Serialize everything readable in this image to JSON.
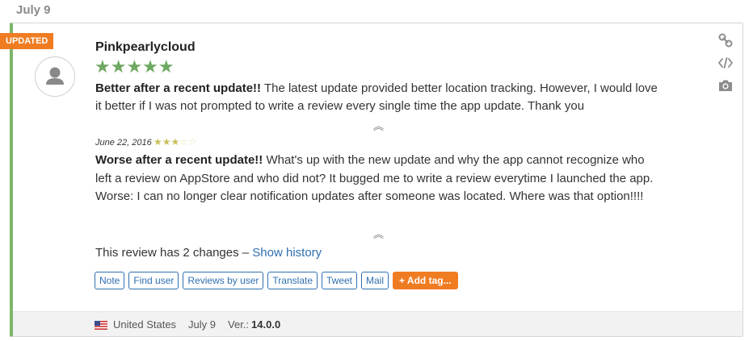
{
  "date_header": "July 9",
  "badge": "UPDATED",
  "author": "Pinkpearlycloud",
  "current_review": {
    "rating": 5,
    "stars": "★★★★★",
    "title": "Better after a recent update!!",
    "body": " The latest update provided better location tracking. However, I would love it better if I was not prompted to write a review every single time the app update. Thank you"
  },
  "previous_review": {
    "date": "June 22, 2016",
    "rating": 3,
    "stars_on": "★★★",
    "stars_off": "☆☆",
    "title": "Worse after a recent update!!",
    "body": " What's up with the new update and why the app cannot recognize who left a review on AppStore and who did not? It bugged me to write a review everytime I launched the app. Worse: I can no longer clear notification updates after someone was located. Where was that option!!!!"
  },
  "collapse_glyph": "︽",
  "changes": {
    "text": "This review has 2 changes – ",
    "link": "Show history"
  },
  "tags": {
    "note": "Note",
    "find_user": "Find user",
    "reviews_by_user": "Reviews by user",
    "translate": "Translate",
    "tweet": "Tweet",
    "mail": "Mail",
    "add_tag": "+ Add tag..."
  },
  "footer": {
    "country": "United States",
    "date": "July 9",
    "version_label": "Ver.:",
    "version": "14.0.0"
  },
  "icons": [
    "link-icon",
    "code-icon",
    "camera-icon",
    "user-avatar-icon",
    "us-flag-icon"
  ],
  "colors": {
    "accent_green": "#7cb66a",
    "badge_orange": "#f07c22",
    "link_blue": "#2f6fb0",
    "star_green": "#6fa862",
    "star_gold": "#c9c05c"
  }
}
